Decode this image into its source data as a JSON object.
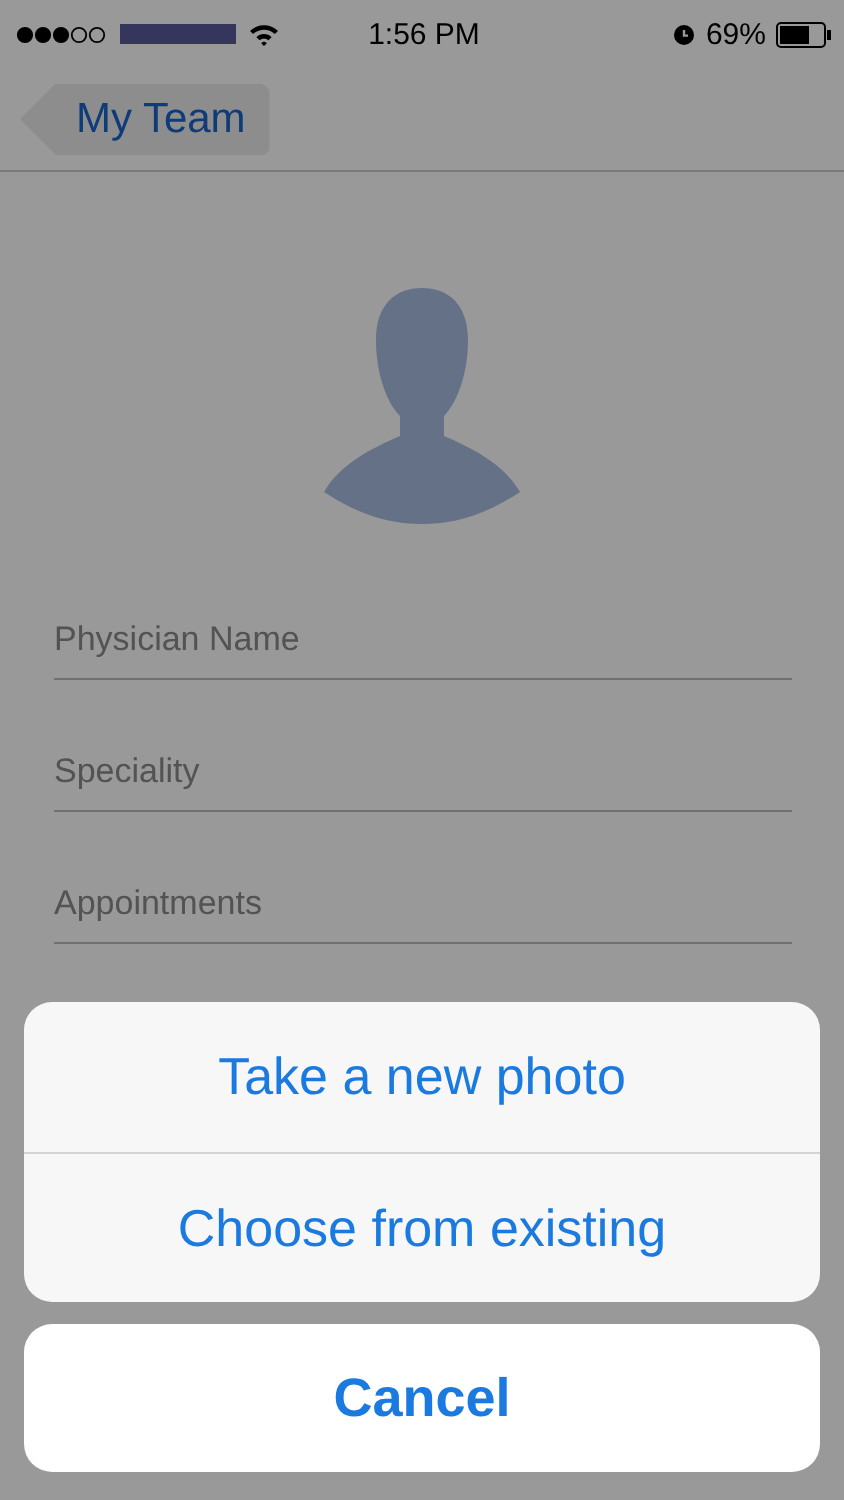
{
  "status_bar": {
    "time": "1:56 PM",
    "battery": "69%"
  },
  "nav": {
    "back_label": "My Team"
  },
  "fields": [
    {
      "placeholder": "Physician Name"
    },
    {
      "placeholder": "Speciality"
    },
    {
      "placeholder": "Appointments"
    }
  ],
  "action_sheet": {
    "actions": [
      "Take a new photo",
      "Choose from existing"
    ],
    "cancel": "Cancel"
  }
}
